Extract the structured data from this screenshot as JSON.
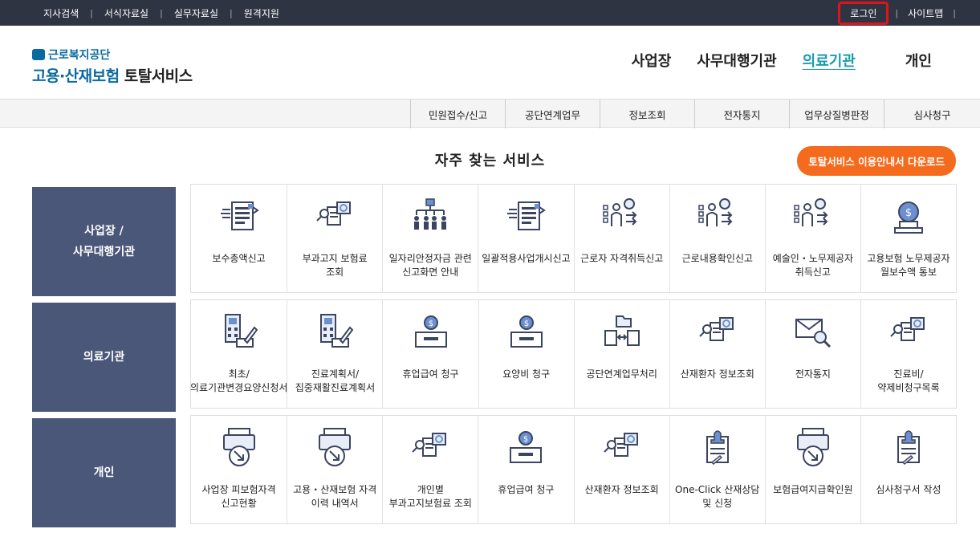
{
  "topbar": {
    "links": [
      "지사검색",
      "서식자료실",
      "실무자료실",
      "원격지원"
    ],
    "login": "로그인",
    "sitemap": "사이트맵"
  },
  "logo": {
    "org": "근로복지공단",
    "title_a": "고용·산재보험",
    "title_b": "토탈서비스"
  },
  "mainnav": [
    "사업장",
    "사무대행기관",
    "의료기관",
    "개인"
  ],
  "subnav": [
    "민원접수/신고",
    "공단연계업무",
    "정보조회",
    "전자통지",
    "업무상질병판정",
    "심사청구"
  ],
  "section_title": "자주 찾는 서비스",
  "download_button": "토탈서비스 이용안내서 다운로드",
  "rows": [
    {
      "category": "사업장 / 사무대행기관",
      "items": [
        {
          "label": "보수총액신고",
          "icon": "document-list-icon"
        },
        {
          "label": "부과고지 보험료 조회",
          "icon": "invoice-search-icon"
        },
        {
          "label": "일자리안정자금 관련 신고화면 안내",
          "icon": "org-chart-icon"
        },
        {
          "label": "일괄적용사업개시신고",
          "icon": "document-list-icon"
        },
        {
          "label": "근로자 자격취득신고",
          "icon": "worker-list-icon"
        },
        {
          "label": "근로내용확인신고",
          "icon": "worker-list-icon"
        },
        {
          "label": "예술인・노무제공자 취득신고",
          "icon": "worker-list-icon"
        },
        {
          "label": "고용보험 노무제공자 월보수액 통보",
          "icon": "money-bag-icon"
        }
      ]
    },
    {
      "category": "의료기관",
      "items": [
        {
          "label": "최초/의료기관변경요양신청서",
          "icon": "hospital-pen-icon"
        },
        {
          "label": "진료계획서/집중재활진료계획서",
          "icon": "hospital-pen-icon"
        },
        {
          "label": "휴업급여 청구",
          "icon": "money-box-icon"
        },
        {
          "label": "요양비 청구",
          "icon": "money-box-icon"
        },
        {
          "label": "공단연계업무처리",
          "icon": "exchange-folder-icon"
        },
        {
          "label": "산재환자 정보조회",
          "icon": "invoice-search-icon"
        },
        {
          "label": "전자통지",
          "icon": "envelope-search-icon"
        },
        {
          "label": "진료비/약제비청구목록",
          "icon": "invoice-search-icon"
        }
      ]
    },
    {
      "category": "개인",
      "items": [
        {
          "label": "사업장 피보험자격 신고현황",
          "icon": "printer-arrow-icon"
        },
        {
          "label": "고용・산재보험 자격 이력 내역서",
          "icon": "printer-arrow-icon"
        },
        {
          "label": "개인별 부과고지보험료 조회",
          "icon": "invoice-search-icon"
        },
        {
          "label": "휴업급여 청구",
          "icon": "money-box-icon"
        },
        {
          "label": "산재환자 정보조회",
          "icon": "invoice-search-icon"
        },
        {
          "label": "One-Click 산재상담 및 신청",
          "icon": "stamp-document-icon"
        },
        {
          "label": "보험급여지급확인원",
          "icon": "printer-arrow-icon"
        },
        {
          "label": "심사청구서 작성",
          "icon": "stamp-document-icon"
        }
      ]
    }
  ]
}
